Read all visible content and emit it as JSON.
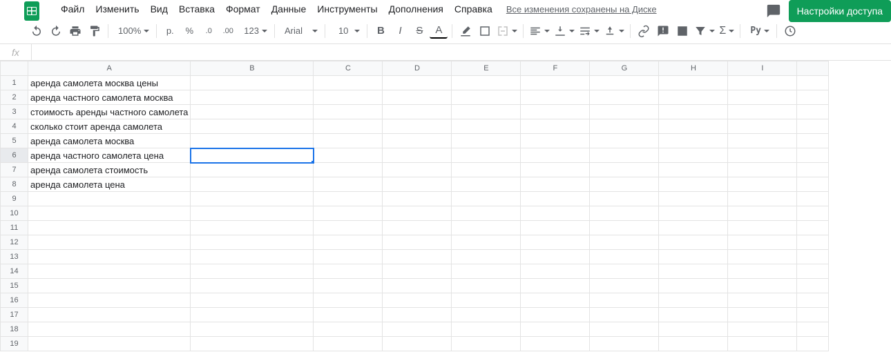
{
  "menus": [
    "Файл",
    "Изменить",
    "Вид",
    "Вставка",
    "Формат",
    "Данные",
    "Инструменты",
    "Дополнения",
    "Справка"
  ],
  "save_status": "Все изменения сохранены на Диске",
  "share_label": "Настройки доступа",
  "toolbar": {
    "zoom": "100%",
    "currency": "р.",
    "percent": "%",
    "dec_less": ".0",
    "dec_more": ".00",
    "more_formats": "123",
    "font": "Arial",
    "font_size": "10",
    "bold": "B",
    "italic": "I",
    "strike": "S",
    "text_color": "A",
    "py": "Py"
  },
  "fx_label": "fx",
  "columns": [
    "A",
    "B",
    "C",
    "D",
    "E",
    "F",
    "G",
    "H",
    "I"
  ],
  "rows": [
    {
      "n": 1,
      "A": "аренда самолета москва цены"
    },
    {
      "n": 2,
      "A": "аренда частного самолета москва"
    },
    {
      "n": 3,
      "A": "стоимость аренды частного самолета"
    },
    {
      "n": 4,
      "A": "сколько стоит аренда самолета"
    },
    {
      "n": 5,
      "A": "аренда самолета москва"
    },
    {
      "n": 6,
      "A": "аренда частного самолета цена"
    },
    {
      "n": 7,
      "A": "аренда самолета стоимость"
    },
    {
      "n": 8,
      "A": "аренда самолета цена"
    },
    {
      "n": 9,
      "A": ""
    },
    {
      "n": 10,
      "A": ""
    },
    {
      "n": 11,
      "A": ""
    },
    {
      "n": 12,
      "A": ""
    },
    {
      "n": 13,
      "A": ""
    },
    {
      "n": 14,
      "A": ""
    },
    {
      "n": 15,
      "A": ""
    },
    {
      "n": 16,
      "A": ""
    },
    {
      "n": 17,
      "A": ""
    },
    {
      "n": 18,
      "A": ""
    },
    {
      "n": 19,
      "A": ""
    }
  ],
  "selected": {
    "row": 6,
    "col": "B"
  }
}
